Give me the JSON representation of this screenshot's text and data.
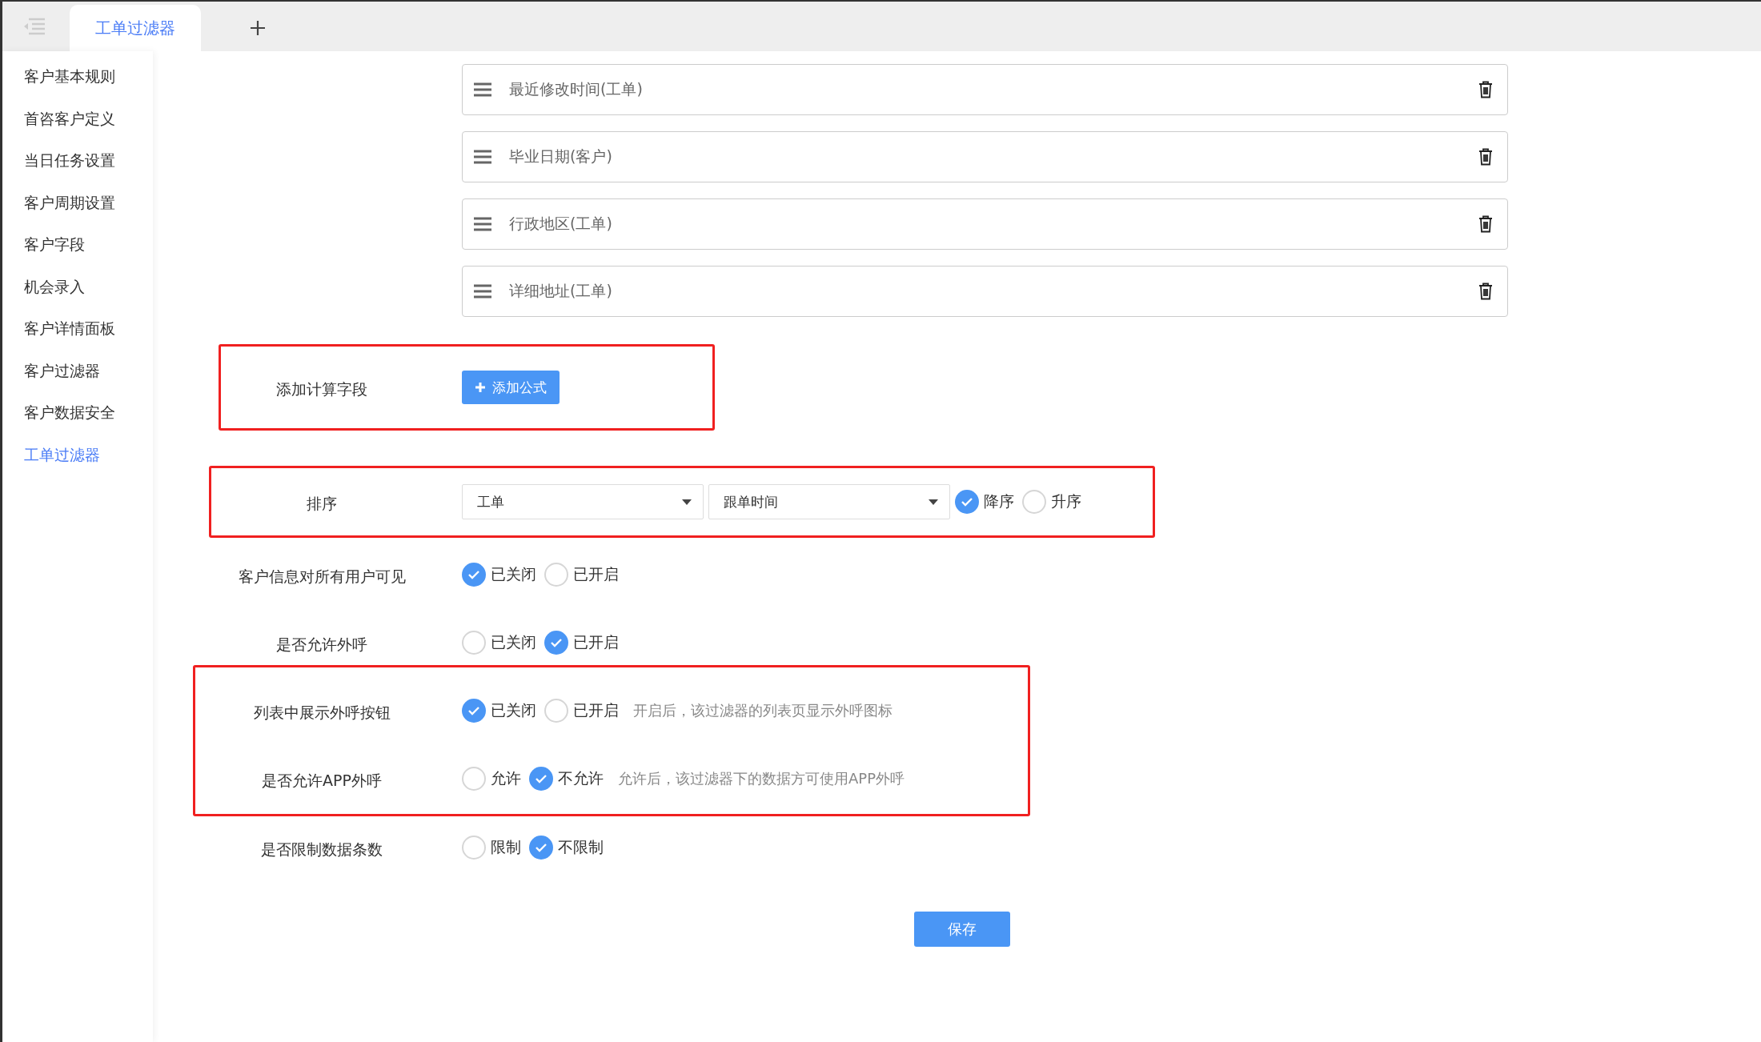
{
  "tabs": [
    {
      "label": "工单过滤器",
      "selected": true
    }
  ],
  "sidebar": {
    "items": [
      {
        "label": "客户基本规则",
        "selected": false
      },
      {
        "label": "首咨客户定义",
        "selected": false
      },
      {
        "label": "当日任务设置",
        "selected": false
      },
      {
        "label": "客户周期设置",
        "selected": false
      },
      {
        "label": "客户字段",
        "selected": false
      },
      {
        "label": "机会录入",
        "selected": false
      },
      {
        "label": "客户详情面板",
        "selected": false
      },
      {
        "label": "客户过滤器",
        "selected": false
      },
      {
        "label": "客户数据安全",
        "selected": false
      },
      {
        "label": "工单过滤器",
        "selected": true
      }
    ]
  },
  "fields": [
    {
      "label": "最近修改时间(工单)"
    },
    {
      "label": "毕业日期(客户)"
    },
    {
      "label": "行政地区(工单)"
    },
    {
      "label": "详细地址(工单)"
    }
  ],
  "groups": [
    {
      "highlighted": true,
      "rows": [
        {
          "kind": "button",
          "label": "添加计算字段",
          "button": "添加公式"
        }
      ]
    },
    {
      "highlighted": true,
      "rows": [
        {
          "kind": "sort",
          "label": "排序",
          "selects": [
            "工单",
            "跟单时间"
          ],
          "options": [
            {
              "label": "降序",
              "selected": true
            },
            {
              "label": "升序",
              "selected": false
            }
          ]
        }
      ]
    },
    {
      "highlighted": false,
      "rows": [
        {
          "kind": "radio",
          "label": "客户信息对所有用户可见",
          "options": [
            {
              "label": "已关闭",
              "selected": true
            },
            {
              "label": "已开启",
              "selected": false
            }
          ]
        },
        {
          "kind": "radio",
          "label": "是否允许外呼",
          "options": [
            {
              "label": "已关闭",
              "selected": false
            },
            {
              "label": "已开启",
              "selected": true
            }
          ]
        }
      ]
    },
    {
      "highlighted": true,
      "rows": [
        {
          "kind": "radio",
          "label": "列表中展示外呼按钮",
          "options": [
            {
              "label": "已关闭",
              "selected": true
            },
            {
              "label": "已开启",
              "selected": false
            }
          ],
          "hint": "开启后，该过滤器的列表页显示外呼图标"
        },
        {
          "kind": "radio",
          "label": "是否允许APP外呼",
          "options": [
            {
              "label": "允许",
              "selected": false
            },
            {
              "label": "不允许",
              "selected": true
            }
          ],
          "hint": "允许后，该过滤器下的数据方可使用APP外呼"
        }
      ]
    },
    {
      "highlighted": false,
      "rows": [
        {
          "kind": "radio",
          "label": "是否限制数据条数",
          "options": [
            {
              "label": "限制",
              "selected": false
            },
            {
              "label": "不限制",
              "selected": true
            }
          ]
        }
      ]
    }
  ],
  "save_button": "保存"
}
